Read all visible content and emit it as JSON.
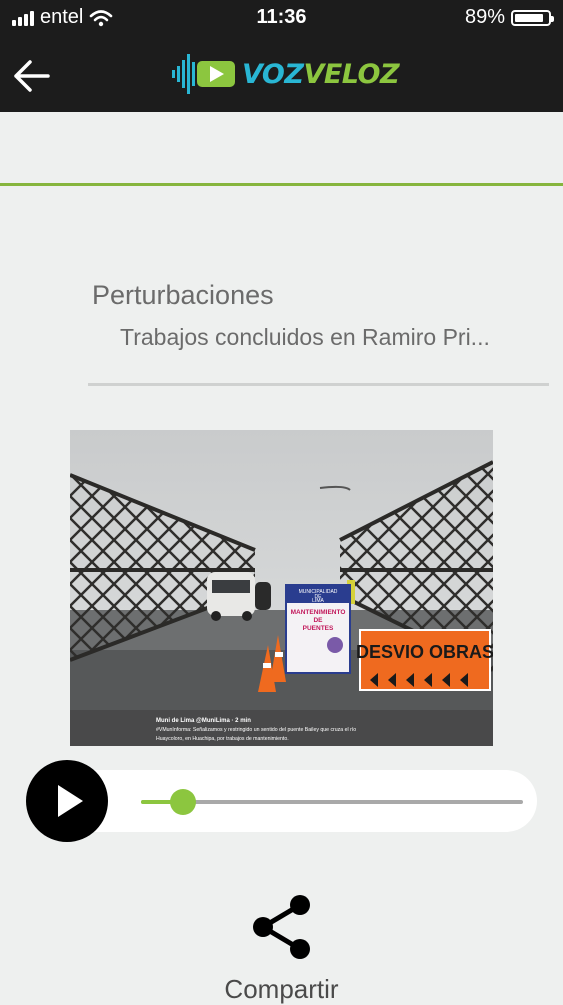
{
  "status_bar": {
    "carrier": "entel",
    "time": "11:36",
    "battery": "89%",
    "battery_level": 0.89
  },
  "header": {
    "back_icon": "arrow-left-icon",
    "logo": {
      "part1": "VOZ",
      "part2": "VELOZ",
      "color1": "#29b6d4",
      "color2": "#8cc63f"
    }
  },
  "article": {
    "category": "Perturbaciones",
    "title": "Trabajos concluidos en Ramiro Pri...",
    "image": {
      "signs": {
        "municipal": [
          "MUNICIPALIDAD",
          "DE",
          "LIMA"
        ],
        "maintenance": [
          "MANTENIMIENTO",
          "DE",
          "PUENTES"
        ],
        "detour": "DESVIO OBRAS"
      },
      "tweet": {
        "author": "Muni de Lima @MuniLima · 2 min",
        "line1": "#VMunInforma: Señalizamos y restringido un sentido del puente Bailey que cruza el río",
        "line2": "Huaycoloro, en Huachipa, por trabajos de mantenimiento."
      }
    }
  },
  "player": {
    "progress": 0.11,
    "play_icon": "play-icon",
    "accent": "#8cc63f"
  },
  "share": {
    "label": "Compartir",
    "icon": "share-icon"
  }
}
